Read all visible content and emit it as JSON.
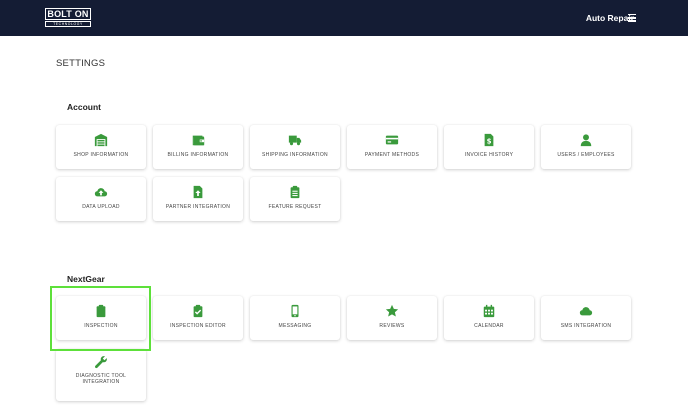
{
  "header": {
    "logo_main": "BOLT ON",
    "logo_sub": "TECHNOLOGY",
    "shop_name": "Auto Repair",
    "menu_icon": "hamburger-menu-icon"
  },
  "page": {
    "title": "SETTINGS"
  },
  "sections": [
    {
      "heading": "Account",
      "tiles": [
        {
          "label": "SHOP INFORMATION",
          "icon": "warehouse-icon"
        },
        {
          "label": "BILLING INFORMATION",
          "icon": "wallet-icon"
        },
        {
          "label": "SHIPPING INFORMATION",
          "icon": "truck-icon"
        },
        {
          "label": "PAYMENT METHODS",
          "icon": "credit-card-icon"
        },
        {
          "label": "INVOICE HISTORY",
          "icon": "invoice-dollar-icon"
        },
        {
          "label": "USERS / EMPLOYEES",
          "icon": "user-icon"
        },
        {
          "label": "DATA UPLOAD",
          "icon": "cloud-upload-icon"
        },
        {
          "label": "PARTNER INTEGRATION",
          "icon": "file-upload-icon"
        },
        {
          "label": "FEATURE REQUEST",
          "icon": "clipboard-list-icon"
        }
      ]
    },
    {
      "heading": "NextGear",
      "tiles": [
        {
          "label": "INSPECTION",
          "icon": "clipboard-icon",
          "selected": true
        },
        {
          "label": "INSPECTION EDITOR",
          "icon": "clipboard-check-icon"
        },
        {
          "label": "MESSAGING",
          "icon": "mobile-phone-icon"
        },
        {
          "label": "REVIEWS",
          "icon": "star-icon"
        },
        {
          "label": "CALENDAR",
          "icon": "calendar-icon"
        },
        {
          "label": "SMS INTEGRATION",
          "icon": "cloud-icon"
        },
        {
          "label": "DIAGNOSTIC TOOL INTEGRATION",
          "icon": "wrench-icon"
        }
      ]
    }
  ],
  "colors": {
    "header_bg": "#141c34",
    "icon_green": "#3a9a3c",
    "selection_outline": "#5de03a"
  }
}
